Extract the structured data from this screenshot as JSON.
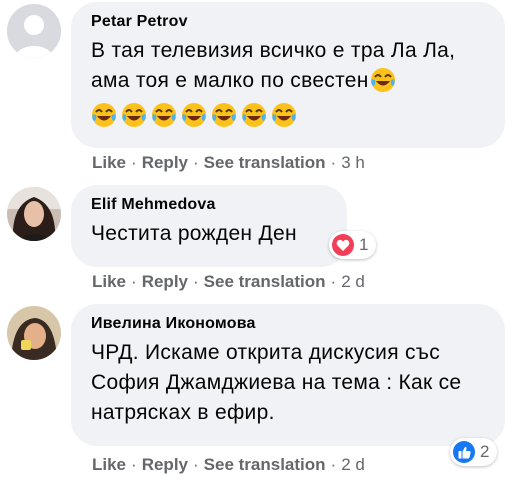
{
  "comments": [
    {
      "author": "Petar Petrov",
      "text": "В тая телевизия всичко е тра Ла Ла, ама тоя е малко по свестен",
      "emoji_count": 8,
      "actions": {
        "like": "Like",
        "reply": "Reply",
        "translate": "See translation",
        "time": "3 h"
      }
    },
    {
      "author": "Elif Mehmedova",
      "text": "Честита рожден Ден",
      "reaction_count": "1",
      "reaction_type": "heart-icon",
      "actions": {
        "like": "Like",
        "reply": "Reply",
        "translate": "See translation",
        "time": "2 d"
      }
    },
    {
      "author": "Ивелина Икономова",
      "text": "ЧРД. Искаме открита дискусия със София Джамджиева на тема : Как се натрясках в ефир.",
      "reaction_count": "2",
      "reaction_type": "like-icon",
      "actions": {
        "like": "Like",
        "reply": "Reply",
        "translate": "See translation",
        "time": "2 d"
      }
    }
  ],
  "separator": "·",
  "colors": {
    "bubble": "#f0f2f5",
    "meta": "#65676b",
    "text": "#050505",
    "heart": "#f33e58",
    "like": "#1877f2"
  }
}
